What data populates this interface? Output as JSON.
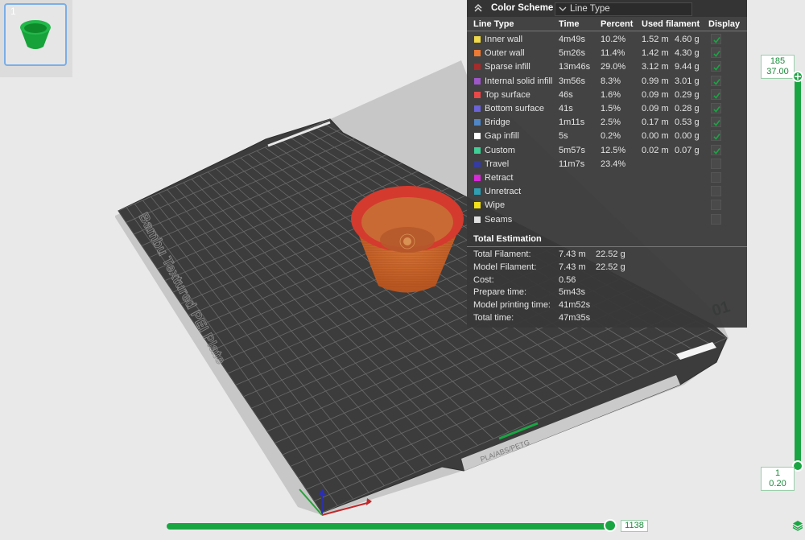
{
  "thumbnail": {
    "plate_number": "1"
  },
  "plate": {
    "label": "Bambu Textured PEI Plate",
    "index": "01",
    "tag": "PLA/ABS/PETG"
  },
  "color_scheme": {
    "title": "Color Scheme",
    "selected": "Line Type",
    "headers": {
      "line_type": "Line Type",
      "time": "Time",
      "percent": "Percent",
      "used_filament": "Used filament",
      "display": "Display"
    },
    "rows": [
      {
        "name": "Inner wall",
        "time": "4m49s",
        "percent": "10.2%",
        "length": "1.52 m",
        "weight": "4.60 g",
        "color": "#f0d94a",
        "display": true
      },
      {
        "name": "Outer wall",
        "time": "5m26s",
        "percent": "11.4%",
        "length": "1.42 m",
        "weight": "4.30 g",
        "color": "#ee7b35",
        "display": true
      },
      {
        "name": "Sparse infill",
        "time": "13m46s",
        "percent": "29.0%",
        "length": "3.12 m",
        "weight": "9.44 g",
        "color": "#a62b2b",
        "display": true
      },
      {
        "name": "Internal solid infill",
        "time": "3m56s",
        "percent": "8.3%",
        "length": "0.99 m",
        "weight": "3.01 g",
        "color": "#9d57c7",
        "display": true
      },
      {
        "name": "Top surface",
        "time": "46s",
        "percent": "1.6%",
        "length": "0.09 m",
        "weight": "0.29 g",
        "color": "#e94848",
        "display": true
      },
      {
        "name": "Bottom surface",
        "time": "41s",
        "percent": "1.5%",
        "length": "0.09 m",
        "weight": "0.28 g",
        "color": "#6b63d7",
        "display": true
      },
      {
        "name": "Bridge",
        "time": "1m11s",
        "percent": "2.5%",
        "length": "0.17 m",
        "weight": "0.53 g",
        "color": "#4f86c6",
        "display": true
      },
      {
        "name": "Gap infill",
        "time": "5s",
        "percent": "0.2%",
        "length": "0.00 m",
        "weight": "0.00 g",
        "color": "#ffffff",
        "display": true
      },
      {
        "name": "Custom",
        "time": "5m57s",
        "percent": "12.5%",
        "length": "0.02 m",
        "weight": "0.07 g",
        "color": "#3fcf97",
        "display": true
      },
      {
        "name": "Travel",
        "time": "11m7s",
        "percent": "23.4%",
        "length": "",
        "weight": "",
        "color": "#353ba0",
        "display": false
      },
      {
        "name": "Retract",
        "time": "",
        "percent": "",
        "length": "",
        "weight": "",
        "color": "#d62ad6",
        "display": false
      },
      {
        "name": "Unretract",
        "time": "",
        "percent": "",
        "length": "",
        "weight": "",
        "color": "#2f9fb3",
        "display": false
      },
      {
        "name": "Wipe",
        "time": "",
        "percent": "",
        "length": "",
        "weight": "",
        "color": "#f2e01b",
        "display": false
      },
      {
        "name": "Seams",
        "time": "",
        "percent": "",
        "length": "",
        "weight": "",
        "color": "#e0e0e0",
        "display": false
      }
    ]
  },
  "total_estimation": {
    "title": "Total Estimation",
    "rows": [
      {
        "label": "Total Filament:",
        "value": "7.43 m",
        "value2": "22.52 g"
      },
      {
        "label": "Model Filament:",
        "value": "7.43 m",
        "value2": "22.52 g"
      },
      {
        "label": "Cost:",
        "value": "0.56",
        "value2": ""
      },
      {
        "label": "Prepare time:",
        "value": "5m43s",
        "value2": ""
      },
      {
        "label": "Model printing time:",
        "value": "41m52s",
        "value2": ""
      },
      {
        "label": "Total time:",
        "value": "47m35s",
        "value2": ""
      }
    ]
  },
  "layer_slider": {
    "top_layer": "185",
    "top_height": "37.00",
    "bottom_layer": "1",
    "bottom_height": "0.20"
  },
  "move_slider": {
    "value": "1138"
  },
  "colors": {
    "accent": "#1aa543",
    "panel_bg": "#383838",
    "model": "#c8622a",
    "infill": "#d43a2e"
  },
  "icons": [
    "collapse-up-icon",
    "chevron-down-icon",
    "checkmark-icon",
    "layers-icon"
  ]
}
